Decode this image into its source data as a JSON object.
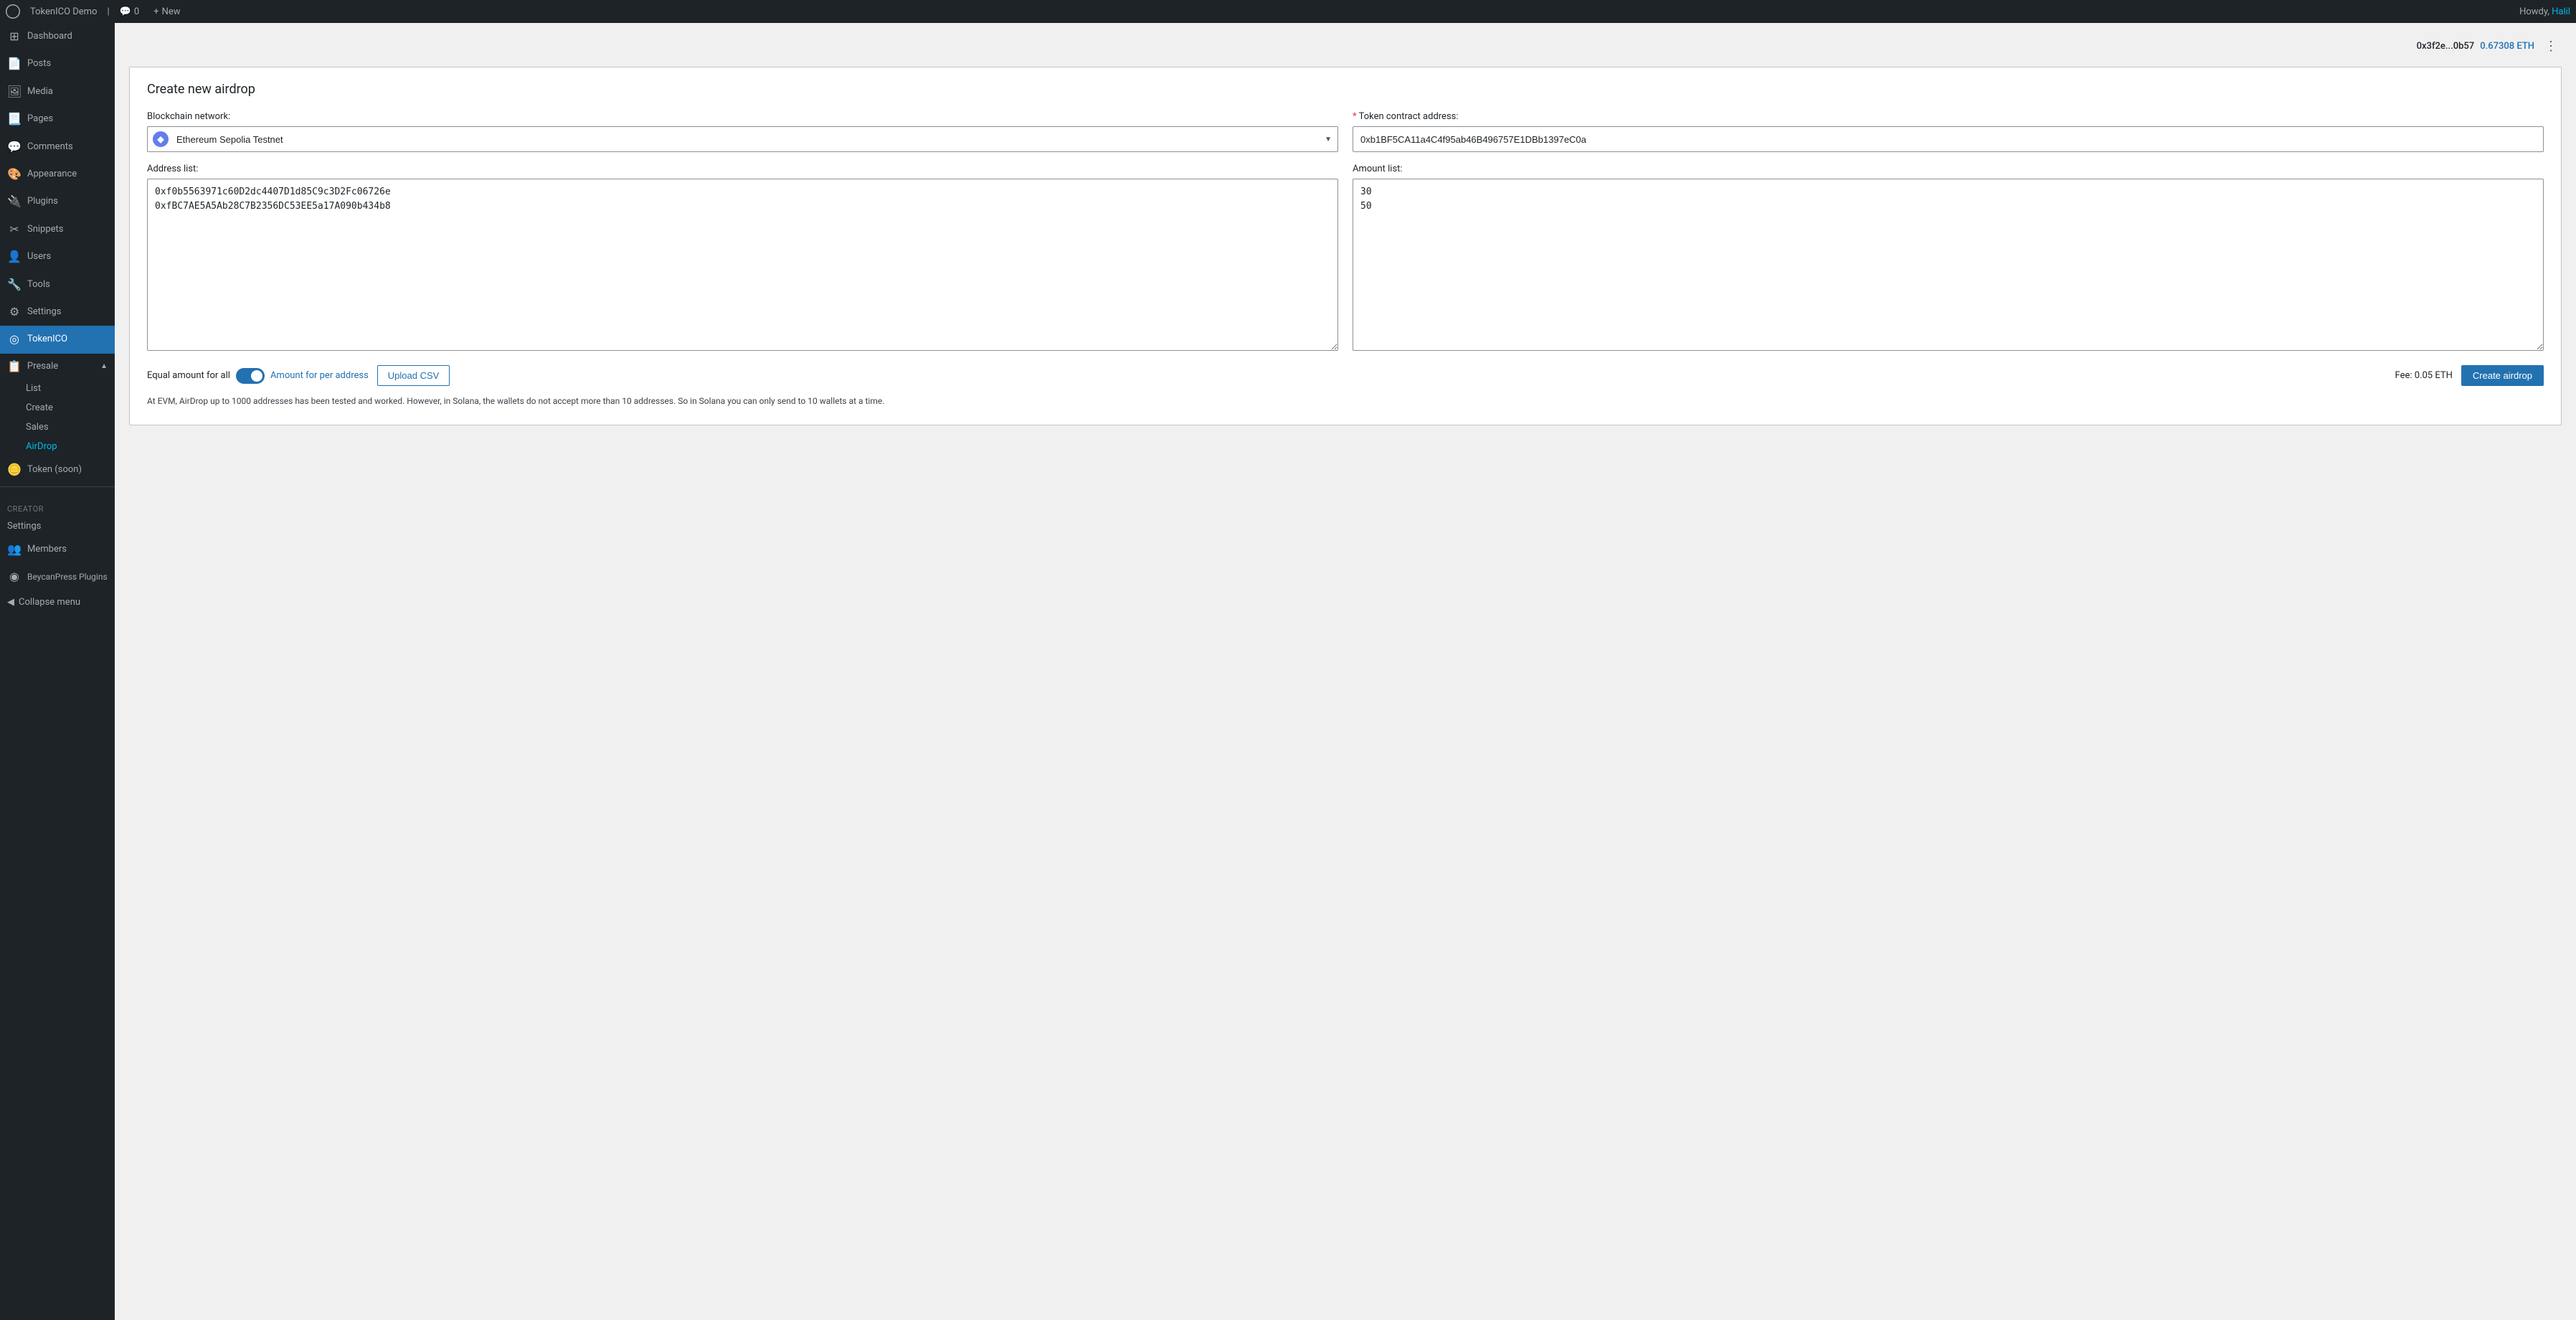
{
  "topbar": {
    "wp_logo_title": "WordPress",
    "site_name": "TokenICO Demo",
    "comments_label": "0",
    "new_label": "New",
    "howdy_text": "Howdy,",
    "username": "Halil"
  },
  "sidebar": {
    "dashboard_label": "Dashboard",
    "posts_label": "Posts",
    "media_label": "Media",
    "pages_label": "Pages",
    "comments_label": "Comments",
    "appearance_label": "Appearance",
    "plugins_label": "Plugins",
    "snippets_label": "Snippets",
    "users_label": "Users",
    "tools_label": "Tools",
    "settings_label": "Settings",
    "tokerico_label": "TokenICO",
    "presale_label": "Presale",
    "presale_sub": {
      "list_label": "List",
      "create_label": "Create",
      "sales_label": "Sales",
      "airdrop_label": "AirDrop"
    },
    "creator_section": "Creator",
    "creator_settings_label": "Settings",
    "members_label": "Members",
    "beycanpress_label": "BeycanPress Plugins",
    "collapse_label": "Collapse menu",
    "token_label": "Token (soon)"
  },
  "wallet": {
    "address": "0x3f2e...0b57",
    "balance": "0.67308 ETH"
  },
  "page": {
    "title": "Create new airdrop",
    "blockchain_label": "Blockchain network:",
    "blockchain_value": "Ethereum Sepolia Testnet",
    "token_contract_label": "Token contract address:",
    "token_contract_required": "*",
    "token_contract_value": "0xb1BF5CA11a4C4f95ab46B496757E1DBb1397eC0a",
    "address_list_label": "Address list:",
    "address_list_value": "0xf0b5563971c60D2dc4407D1d85C9c3D2Fc06726e\n0xfBC7AE5A5Ab28C7B2356DC53EE5a17A090b434b8",
    "amount_list_label": "Amount list:",
    "amount_list_value": "30\n50",
    "equal_amount_label": "Equal amount for all",
    "amount_per_address_label": "Amount for per address",
    "upload_csv_label": "Upload CSV",
    "fee_label": "Fee: 0.05 ETH",
    "create_button_label": "Create airdrop",
    "info_note": "At EVM, AirDrop up to 1000 addresses has been tested and worked. However, in Solana, the wallets do not accept more than 10 addresses. So in Solana you can only send to 10 wallets at a time."
  },
  "colors": {
    "accent": "#2271b1",
    "sidebar_bg": "#1d2327",
    "active_bg": "#2271b1"
  }
}
